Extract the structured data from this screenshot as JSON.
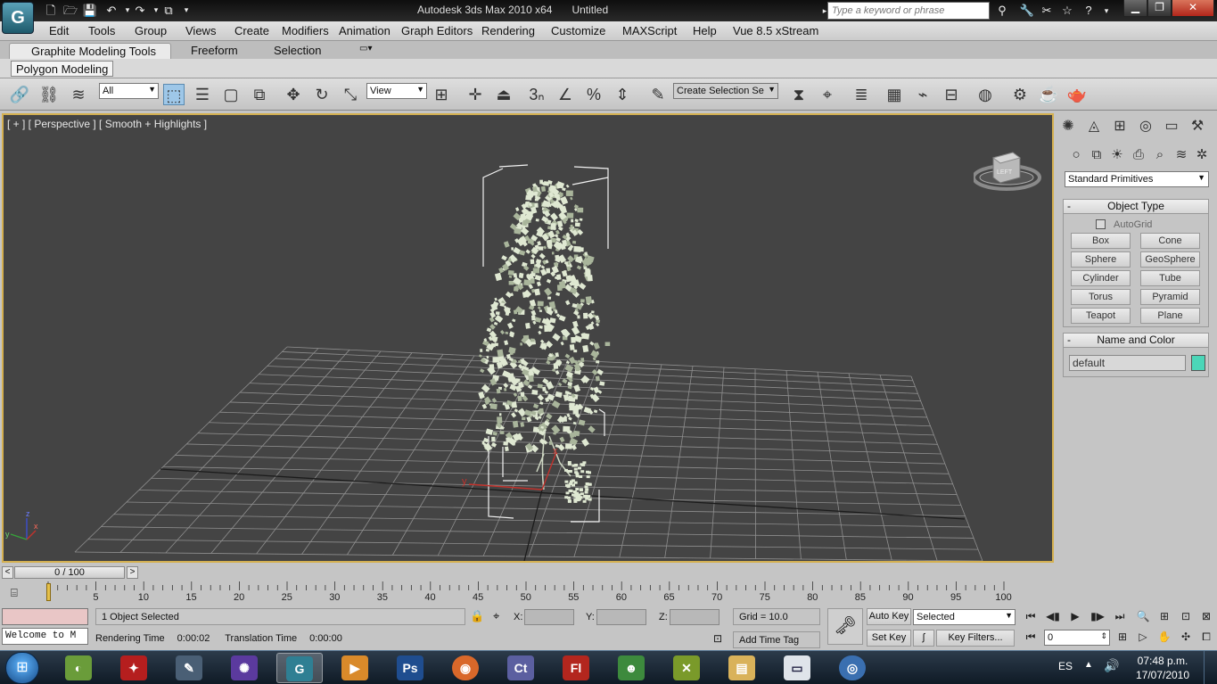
{
  "window": {
    "title": "Autodesk 3ds Max  2010 x64",
    "document": "Untitled",
    "search_placeholder": "Type a keyword or phrase",
    "minimize": "▁",
    "restore": "❐",
    "close": "✕"
  },
  "menu": [
    "Edit",
    "Tools",
    "Group",
    "Views",
    "Create",
    "Modifiers",
    "Animation",
    "Graph Editors",
    "Rendering",
    "Customize",
    "MAXScript",
    "Help",
    "Vue 8.5 xStream"
  ],
  "ribbon": {
    "tabs": [
      "Graphite Modeling Tools",
      "Freeform",
      "Selection"
    ],
    "subtab": "Polygon Modeling"
  },
  "toolbar": {
    "filter_value": "All",
    "refcoord_value": "View",
    "selection_set_placeholder": "Create Selection Se"
  },
  "viewport": {
    "label": "[ + ] [ Perspective ] [ Smooth + Highlights ]",
    "viewcube_face": "LEFT",
    "axis_x": "x",
    "axis_y": "y",
    "axis_z": "z"
  },
  "command_panel": {
    "dropdown_value": "Standard Primitives",
    "object_type_title": "Object Type",
    "autogrid_label": "AutoGrid",
    "primitives": [
      "Box",
      "Cone",
      "Sphere",
      "GeoSphere",
      "Cylinder",
      "Tube",
      "Torus",
      "Pyramid",
      "Teapot",
      "Plane"
    ],
    "name_color_title": "Name and Color",
    "name_value": "default",
    "object_color": "#4bd6b8"
  },
  "timeline": {
    "frame_display": "0 / 100",
    "ticks": [
      "5",
      "10",
      "15",
      "20",
      "25",
      "30",
      "35",
      "40",
      "45",
      "50",
      "55",
      "60",
      "65",
      "70",
      "75",
      "80",
      "85",
      "90",
      "95",
      "100"
    ]
  },
  "status": {
    "welcome": "Welcome to M",
    "selection": "1 Object Selected",
    "rendering_time_label": "Rendering Time",
    "rendering_time": "0:00:02",
    "translation_time_label": "Translation Time",
    "translation_time": "0:00:00",
    "x_label": "X:",
    "y_label": "Y:",
    "z_label": "Z:",
    "grid": "Grid = 10.0",
    "add_time_tag": "Add Time Tag",
    "auto_key": "Auto Key",
    "set_key": "Set Key",
    "key_mode_value": "Selected",
    "key_filters": "Key Filters...",
    "current_frame": "0"
  },
  "taskbar": {
    "language": "ES",
    "time": "07:48 p.m.",
    "date": "17/07/2010",
    "apps": [
      "Ps",
      "Ct",
      "Fl"
    ]
  },
  "colors": {
    "viewport_bg": "#444444",
    "viewport_border": "#d4b050",
    "grid_line": "#8f8f8f",
    "foliage": "#dfe8d2"
  }
}
